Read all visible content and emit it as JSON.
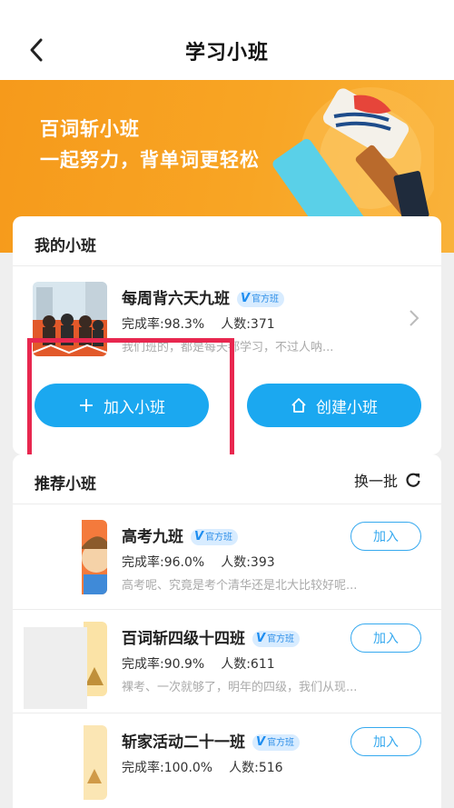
{
  "header": {
    "title": "学习小班",
    "back_icon": "chevron-left-icon"
  },
  "banner": {
    "title": "百词斩小班",
    "subtitle": "一起努力，背单词更轻松"
  },
  "my_groups": {
    "section_title": "我的小班",
    "items": [
      {
        "name": "每周背六天九班",
        "badge": "官方班",
        "completion": "完成率:98.3%",
        "members": "人数:371",
        "description": "我们班的，都是每天都学习，不过人呐..."
      }
    ],
    "join_button": "加入小班",
    "create_button": "创建小班"
  },
  "recommended": {
    "section_title": "推荐小班",
    "refresh_label": "换一批",
    "items": [
      {
        "name": "高考九班",
        "badge": "官方班",
        "completion": "完成率:96.0%",
        "members": "人数:393",
        "description": "高考呢、究竟是考个清华还是北大比较好呢...",
        "action": "加入"
      },
      {
        "name": "百词斩四级十四班",
        "badge": "官方班",
        "completion": "完成率:90.9%",
        "members": "人数:611",
        "description": "裸考、一次就够了，明年的四级，我们从现...",
        "action": "加入"
      },
      {
        "name": "斩家活动二十一班",
        "badge": "官方班",
        "completion": "完成率:100.0%",
        "members": "人数:516",
        "description": "",
        "action": "加入"
      }
    ]
  },
  "colors": {
    "accent": "#1ba8f0",
    "banner": "#f8a524",
    "highlight": "#e8274f"
  }
}
